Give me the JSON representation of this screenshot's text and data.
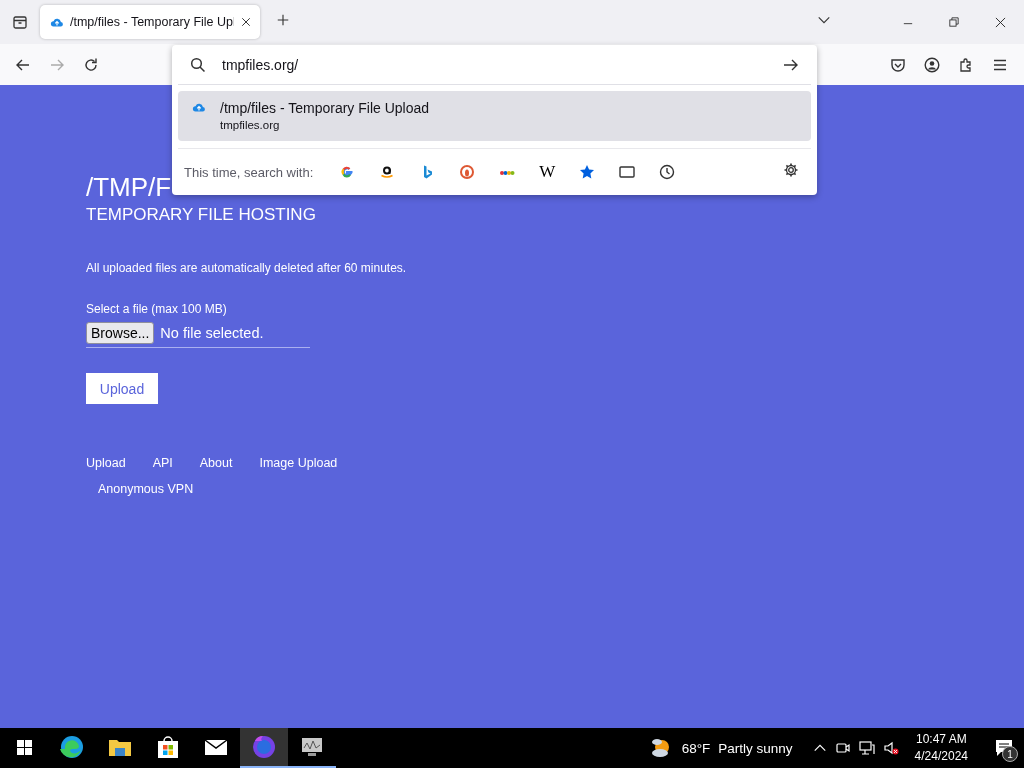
{
  "browser": {
    "tabs": [
      {
        "title": "/tmp/files - Temporary File Upl",
        "selected": true
      }
    ],
    "address_bar": {
      "value": "tmpfiles.org/"
    },
    "suggestions": [
      {
        "title": "/tmp/files - Temporary File Upload",
        "url": "tmpfiles.org",
        "selected": true
      }
    ],
    "search_with": {
      "label": "This time, search with:",
      "engines": [
        {
          "kind": "google"
        },
        {
          "kind": "amazon"
        },
        {
          "kind": "bing"
        },
        {
          "kind": "duckduckgo"
        },
        {
          "kind": "ebay"
        },
        {
          "kind": "wikipedia",
          "glyph": "W"
        },
        {
          "kind": "bookmarks"
        },
        {
          "kind": "tabs"
        },
        {
          "kind": "history"
        }
      ]
    }
  },
  "page": {
    "heading": "/TMP/F",
    "subtitle": "TEMPORARY FILE HOSTING",
    "notice": "All uploaded files are automatically deleted after 60 minutes.",
    "file_label": "Select a file (max 100 MB)",
    "browse_button": "Browse...",
    "file_status": "No file selected.",
    "upload_button": "Upload",
    "footer_links": [
      {
        "label": "Upload"
      },
      {
        "label": "API"
      },
      {
        "label": "About"
      },
      {
        "label": "Image Upload"
      },
      {
        "label": "Anonymous VPN"
      }
    ]
  },
  "taskbar": {
    "apps": [
      {
        "kind": "edge",
        "active": false,
        "running": false
      },
      {
        "kind": "files",
        "active": false,
        "running": false
      },
      {
        "kind": "store",
        "active": false,
        "running": false
      },
      {
        "kind": "mail",
        "active": false,
        "running": false
      },
      {
        "kind": "firefox",
        "active": true,
        "running": true
      },
      {
        "kind": "monitor",
        "active": false,
        "running": true
      }
    ],
    "temperature": "68°F",
    "weather": "Partly sunny",
    "time": "10:47 AM",
    "date": "4/24/2024",
    "notifications": "1"
  }
}
